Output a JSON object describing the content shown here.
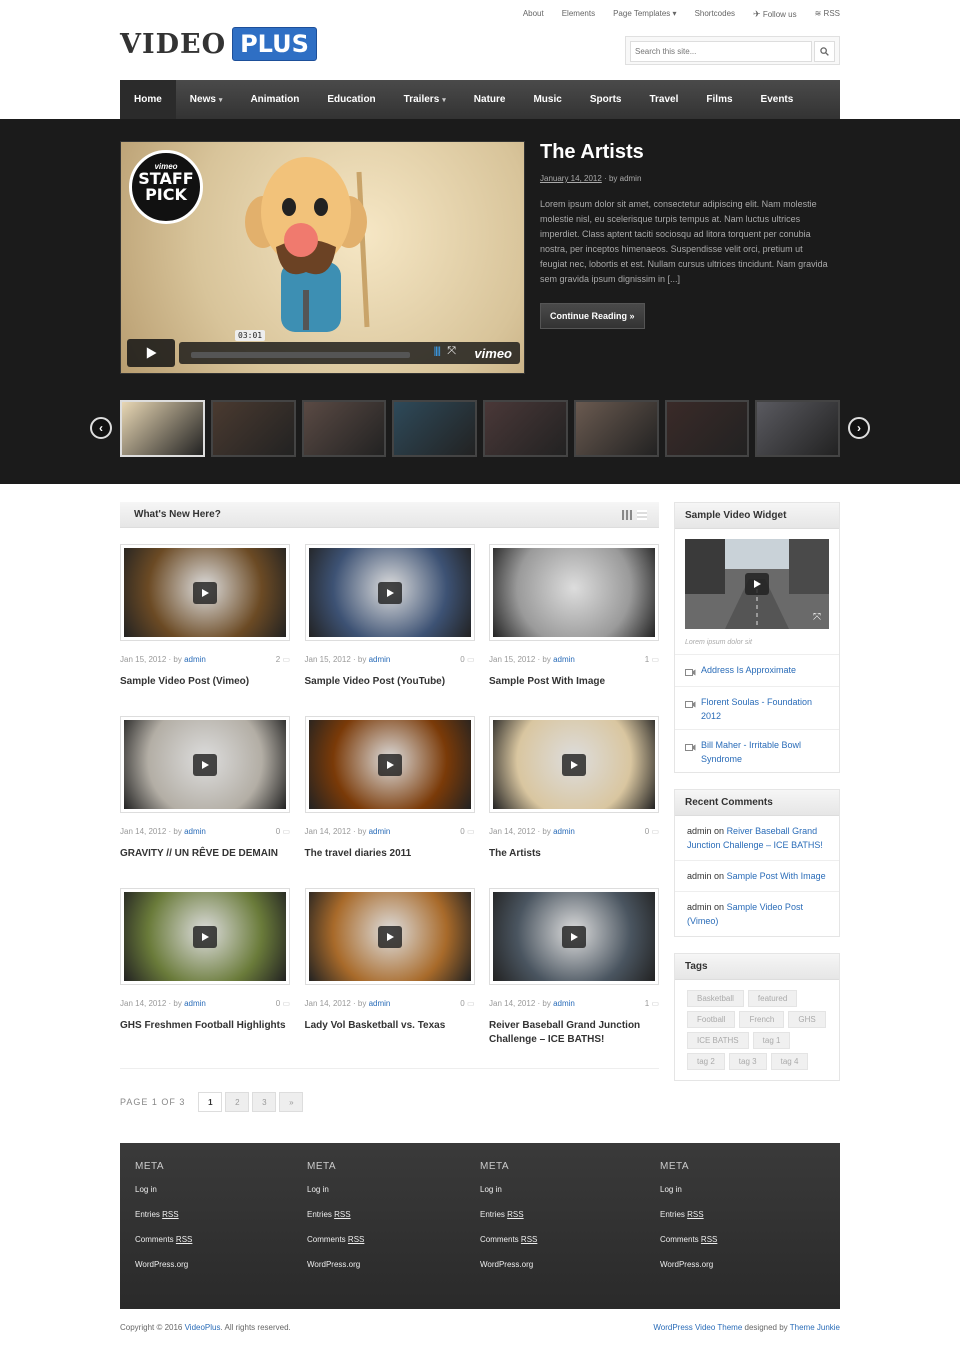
{
  "topbar": {
    "about": "About",
    "elements": "Elements",
    "page_templates": "Page Templates",
    "shortcodes": "Shortcodes",
    "follow": "Follow us",
    "rss": "RSS"
  },
  "logo": {
    "part1": "VIDEO",
    "part2": "PLUS",
    "accent": "#2f6fc4"
  },
  "search": {
    "placeholder": "Search this site..."
  },
  "nav": [
    {
      "label": "Home",
      "dropdown": false
    },
    {
      "label": "News",
      "dropdown": true
    },
    {
      "label": "Animation",
      "dropdown": false
    },
    {
      "label": "Education",
      "dropdown": false
    },
    {
      "label": "Trailers",
      "dropdown": true
    },
    {
      "label": "Nature",
      "dropdown": false
    },
    {
      "label": "Music",
      "dropdown": false
    },
    {
      "label": "Sports",
      "dropdown": false
    },
    {
      "label": "Travel",
      "dropdown": false
    },
    {
      "label": "Films",
      "dropdown": false
    },
    {
      "label": "Events",
      "dropdown": false
    }
  ],
  "hero": {
    "title": "The Artists",
    "date": "January 14, 2012",
    "by": "· by admin",
    "excerpt": "Lorem ipsum dolor sit amet, consectetur adipiscing elit. Nam molestie molestie nisl, eu scelerisque turpis tempus at. Nam luctus ultrices imperdiet. Class aptent taciti sociosqu ad litora torquent per conubia nostra, per inceptos himenaeos. Suspendisse velit orci, pretium ut feugiat nec, lobortis et est. Nullam cursus ultrices tincidunt. Nam gravida sem gravida ipsum dignissim in [...]",
    "button": "Continue Reading »",
    "video_time": "03:01",
    "badge_vimeo": "vimeo",
    "badge_text1": "STAFF",
    "badge_text2": "PICK",
    "player_logo": "vimeo"
  },
  "main": {
    "heading": "What's New Here?"
  },
  "posts": [
    {
      "date": "Jan 15, 2012",
      "by": "· by",
      "author": "admin",
      "comments": "2",
      "title": "Sample Video Post (Vimeo)",
      "bg": "#6b4a24"
    },
    {
      "date": "Jan 15, 2012",
      "by": "· by",
      "author": "admin",
      "comments": "0",
      "title": "Sample Video Post (YouTube)",
      "bg": "#3d5274"
    },
    {
      "date": "Jan 15, 2012",
      "by": "· by",
      "author": "admin",
      "comments": "1",
      "title": "Sample Post With Image",
      "bg": "#9a9a9a"
    },
    {
      "date": "Jan 14, 2012",
      "by": "· by",
      "author": "admin",
      "comments": "0",
      "title": "GRAVITY // UN RÊVE DE DEMAIN",
      "bg": "#b3aea5"
    },
    {
      "date": "Jan 14, 2012",
      "by": "· by",
      "author": "admin",
      "comments": "0",
      "title": "The travel diaries 2011",
      "bg": "#7a3a08"
    },
    {
      "date": "Jan 14, 2012",
      "by": "· by",
      "author": "admin",
      "comments": "0",
      "title": "The Artists",
      "bg": "#d9c6a0"
    },
    {
      "date": "Jan 14, 2012",
      "by": "· by",
      "author": "admin",
      "comments": "0",
      "title": "GHS Freshmen Football Highlights",
      "bg": "#6a7b3a"
    },
    {
      "date": "Jan 14, 2012",
      "by": "· by",
      "author": "admin",
      "comments": "0",
      "title": "Lady Vol Basketball vs. Texas",
      "bg": "#a86a2a"
    },
    {
      "date": "Jan 14, 2012",
      "by": "· by",
      "author": "admin",
      "comments": "1",
      "title": "Reiver Baseball Grand Junction Challenge – ICE BATHS!",
      "bg": "#4a5560"
    }
  ],
  "pager": {
    "label": "PAGE 1 OF 3",
    "pages": [
      "1",
      "2",
      "3",
      "»"
    ]
  },
  "sidebar": {
    "video_widget": {
      "title": "Sample Video Widget",
      "caption": "Lorem ipsum dolor sit",
      "links": [
        "Address Is Approximate",
        "Florent Soulas - Foundation 2012",
        "Bill Maher - Irritable Bowl Syndrome"
      ]
    },
    "recent_comments": {
      "title": "Recent Comments",
      "items": [
        {
          "who": "admin",
          "on": "on",
          "link": "Reiver Baseball Grand Junction Challenge – ICE BATHS!"
        },
        {
          "who": "admin",
          "on": "on",
          "link": "Sample Post With Image"
        },
        {
          "who": "admin",
          "on": "on",
          "link": "Sample Video Post (Vimeo)"
        }
      ]
    },
    "tags": {
      "title": "Tags",
      "items": [
        "Basketball",
        "featured",
        "Football",
        "French",
        "GHS",
        "ICE BATHS",
        "tag 1",
        "tag 2",
        "tag 3",
        "tag 4"
      ]
    }
  },
  "footer": {
    "columns": [
      {
        "title": "META",
        "login": "Log in",
        "entries": "Entries",
        "comments": "Comments",
        "rss": "RSS",
        "wp": "WordPress.org"
      },
      {
        "title": "META",
        "login": "Log in",
        "entries": "Entries",
        "comments": "Comments",
        "rss": "RSS",
        "wp": "WordPress.org"
      },
      {
        "title": "META",
        "login": "Log in",
        "entries": "Entries",
        "comments": "Comments",
        "rss": "RSS",
        "wp": "WordPress.org"
      },
      {
        "title": "META",
        "login": "Log in",
        "entries": "Entries",
        "comments": "Comments",
        "rss": "RSS",
        "wp": "WordPress.org"
      }
    ]
  },
  "copyright": {
    "pre": "Copyright © 2016",
    "site": "VideoPlus",
    "post": ". All rights reserved."
  },
  "credit": {
    "theme": "WordPress Video Theme",
    "mid": "designed by",
    "author": "Theme Junkie"
  }
}
